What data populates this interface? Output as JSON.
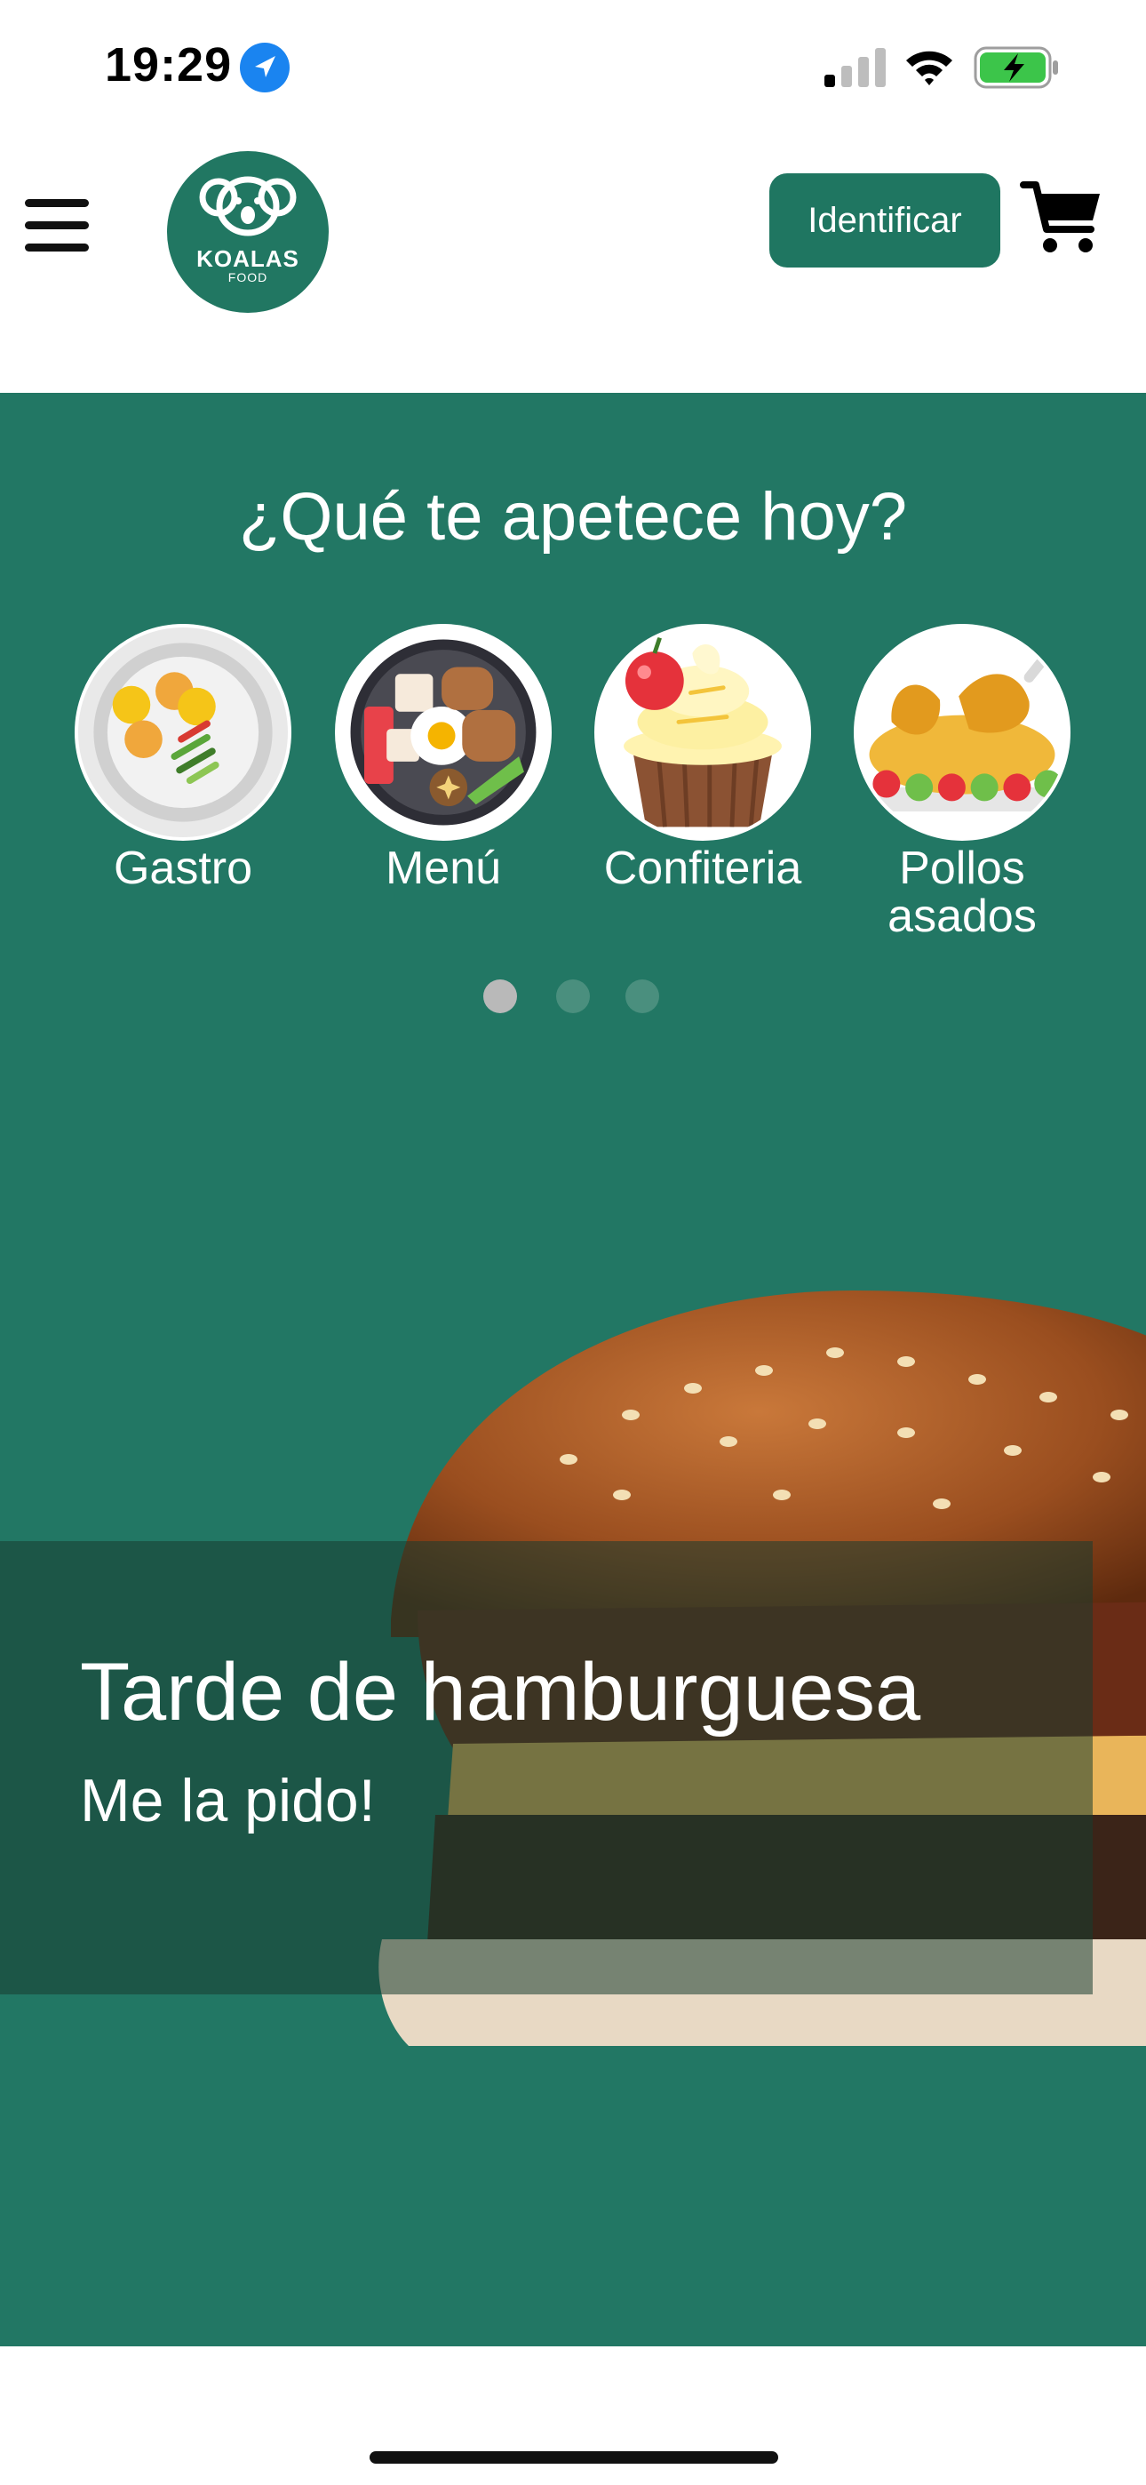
{
  "status_bar": {
    "time": "19:29",
    "icons": [
      "location-arrow-icon",
      "cellular-signal-icon",
      "wifi-icon",
      "battery-charging-icon"
    ]
  },
  "header": {
    "logo_text": "KOALAS",
    "logo_subtext": "FOOD",
    "identify_label": "Identificar",
    "icons": [
      "hamburger-menu-icon",
      "shopping-cart-icon"
    ]
  },
  "hero": {
    "title": "¿Qué te apetece hoy?",
    "categories": [
      {
        "label": "Gastro",
        "icon": "plate-icon"
      },
      {
        "label": "Menú",
        "icon": "breakfast-pan-icon"
      },
      {
        "label": "Confiteria",
        "icon": "cupcake-icon"
      },
      {
        "label": "Pollos asados",
        "icon": "roast-chicken-icon"
      }
    ],
    "carousel_pages": 3,
    "carousel_active": 1
  },
  "promo": {
    "title": "Tarde de hamburguesa",
    "subtitle": "Me la pido!"
  },
  "colors": {
    "brand_green": "#227764",
    "button_green": "#1f7661",
    "white": "#ffffff"
  }
}
